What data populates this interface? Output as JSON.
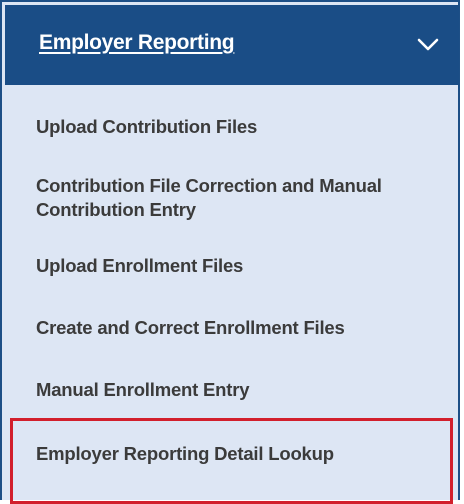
{
  "menu": {
    "header": {
      "title": "Employer Reporting",
      "toggle_icon": "chevron-down-icon"
    },
    "items": [
      {
        "label": "Upload Contribution Files"
      },
      {
        "label": "Contribution File Correction and Manual Contribution Entry"
      },
      {
        "label": "Upload Enrollment Files"
      },
      {
        "label": "Create and Correct Enrollment Files"
      },
      {
        "label": "Manual Enrollment Entry"
      },
      {
        "label": "Employer Reporting Detail Lookup"
      }
    ]
  },
  "colors": {
    "header_bg": "#1a4d86",
    "panel_bg": "#dde6f4",
    "item_text": "#3b3b3b",
    "highlight": "#d21f2c"
  }
}
